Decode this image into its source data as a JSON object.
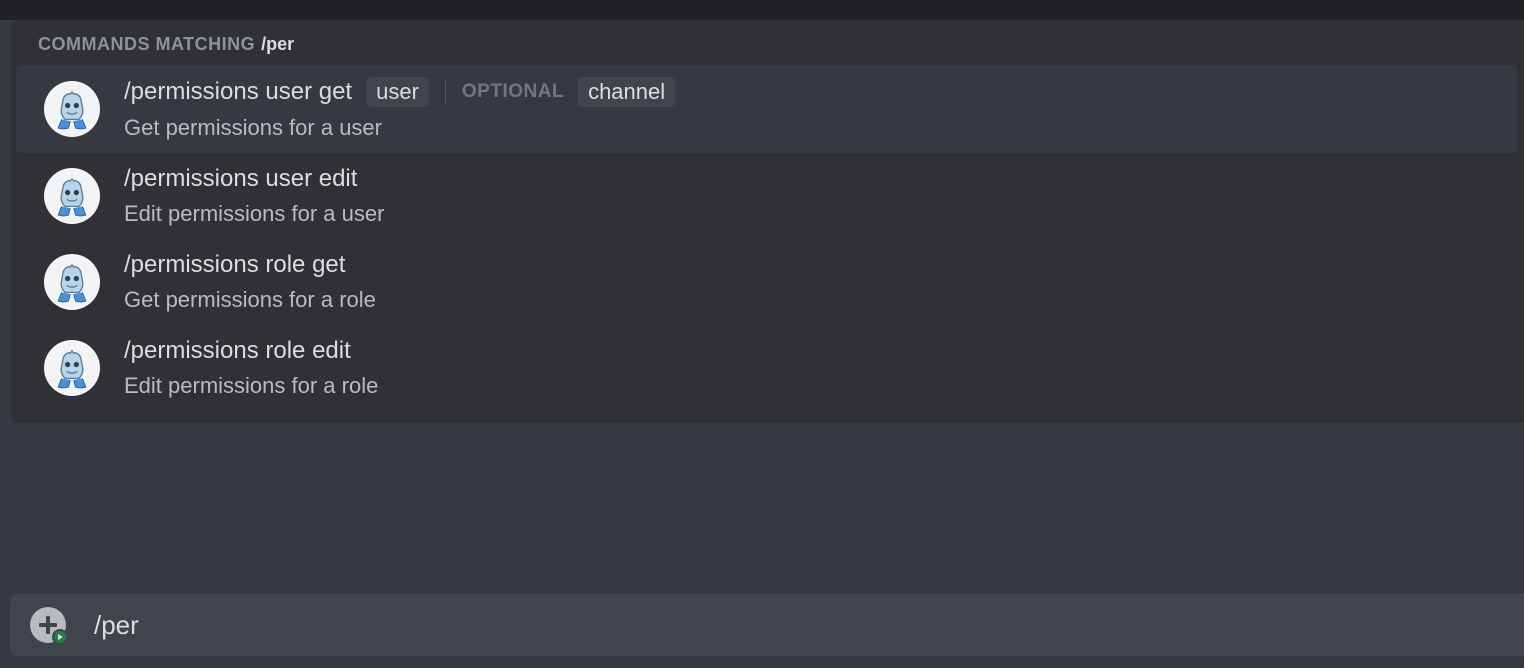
{
  "header": {
    "label": "COMMANDS MATCHING",
    "query": "/per"
  },
  "commands": [
    {
      "name": "/permissions user get",
      "description": "Get permissions for a user",
      "params": [
        {
          "label": "user",
          "optional": false
        },
        {
          "label": "channel",
          "optional": true
        }
      ],
      "optional_label": "OPTIONAL",
      "selected": true
    },
    {
      "name": "/permissions user edit",
      "description": "Edit permissions for a user",
      "params": [],
      "selected": false
    },
    {
      "name": "/permissions role get",
      "description": "Get permissions for a role",
      "params": [],
      "selected": false
    },
    {
      "name": "/permissions role edit",
      "description": "Edit permissions for a role",
      "params": [],
      "selected": false
    }
  ],
  "input": {
    "value": "/per"
  }
}
